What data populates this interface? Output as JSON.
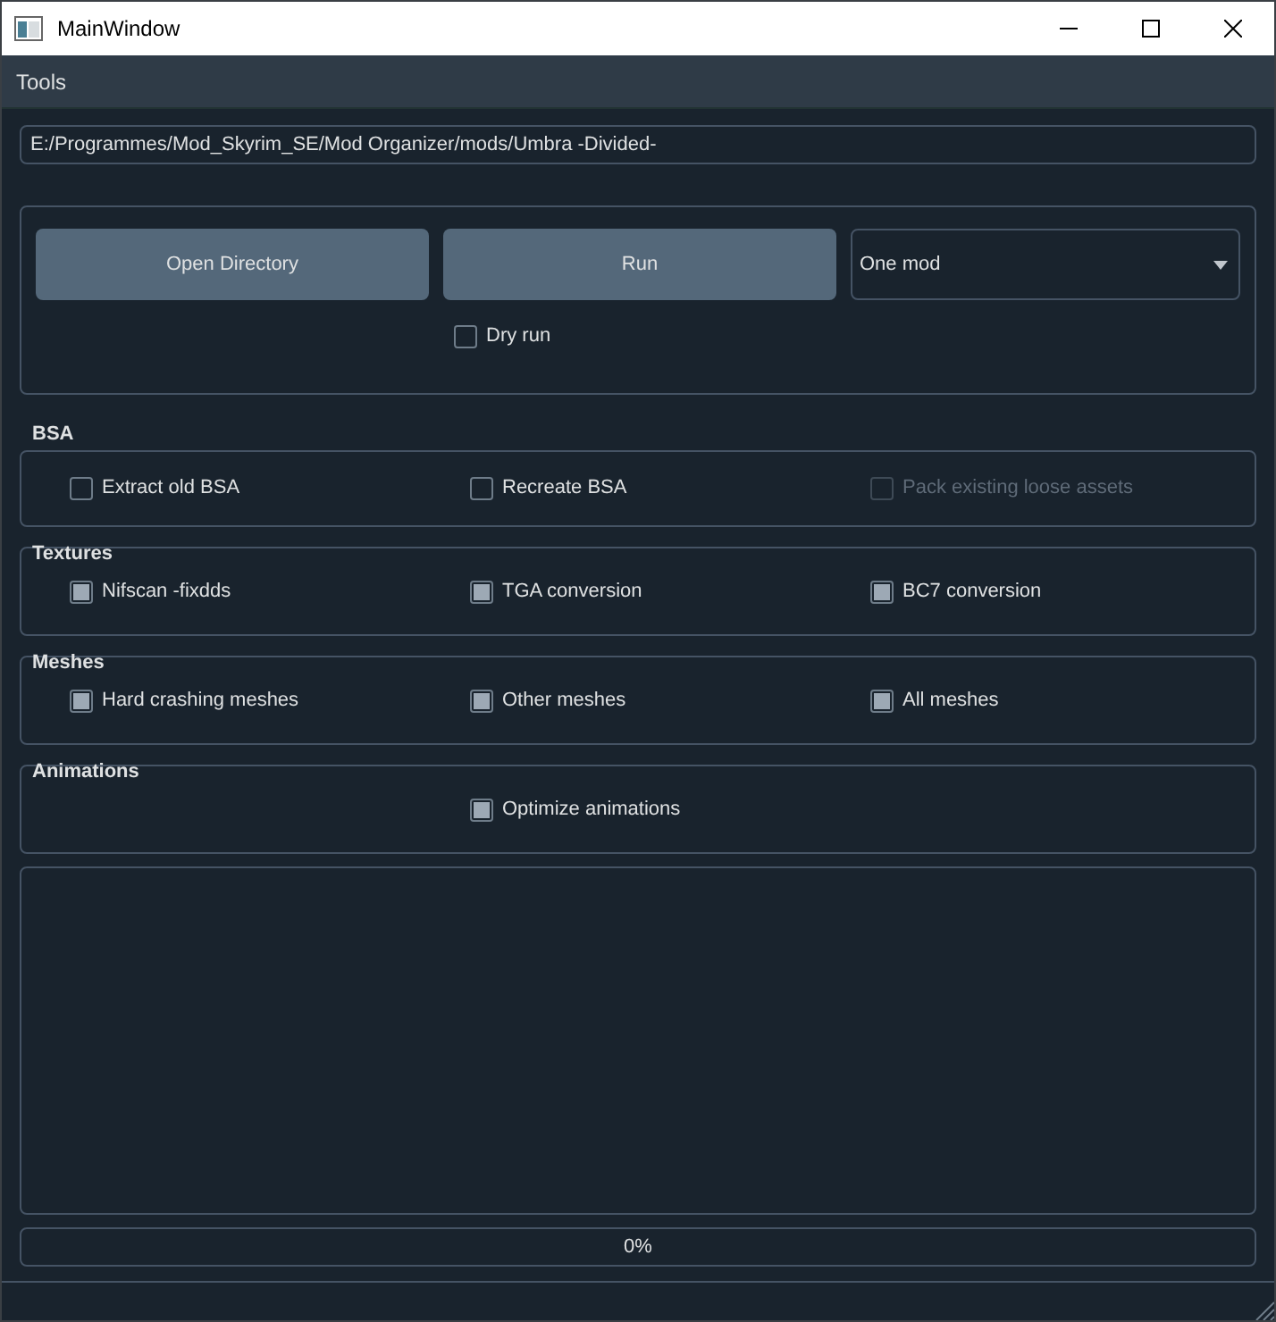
{
  "window": {
    "title": "MainWindow"
  },
  "menu": [
    {
      "label": "Tools"
    }
  ],
  "path_field": {
    "value": "E:/Programmes/Mod_Skyrim_SE/Mod Organizer/mods/Umbra -Divided-"
  },
  "actions": {
    "buttons": [
      {
        "label": "Open Directory"
      },
      {
        "label": "Run"
      }
    ],
    "mode_select": {
      "value": "One mod"
    },
    "dry_run": {
      "label": "Dry run",
      "checked": false
    }
  },
  "groups": [
    {
      "title": "BSA",
      "items": [
        {
          "label": "Extract old BSA",
          "checked": false,
          "disabled": false
        },
        {
          "label": "Recreate BSA",
          "checked": false,
          "disabled": false
        },
        {
          "label": "Pack existing loose assets",
          "checked": false,
          "disabled": true
        }
      ]
    },
    {
      "title": "Textures",
      "items": [
        {
          "label": "Nifscan -fixdds",
          "checked": true,
          "disabled": false
        },
        {
          "label": "TGA conversion",
          "checked": true,
          "disabled": false
        },
        {
          "label": "BC7 conversion",
          "checked": true,
          "disabled": false
        }
      ]
    },
    {
      "title": "Meshes",
      "items": [
        {
          "label": "Hard crashing meshes",
          "checked": true,
          "disabled": false
        },
        {
          "label": "Other meshes",
          "checked": true,
          "disabled": false
        },
        {
          "label": "All meshes",
          "checked": true,
          "disabled": false
        }
      ]
    },
    {
      "title": "Animations",
      "items": [
        {
          "label": "Optimize animations",
          "checked": true,
          "disabled": false
        }
      ]
    }
  ],
  "progress": {
    "level": 0,
    "reading": "0%"
  }
}
